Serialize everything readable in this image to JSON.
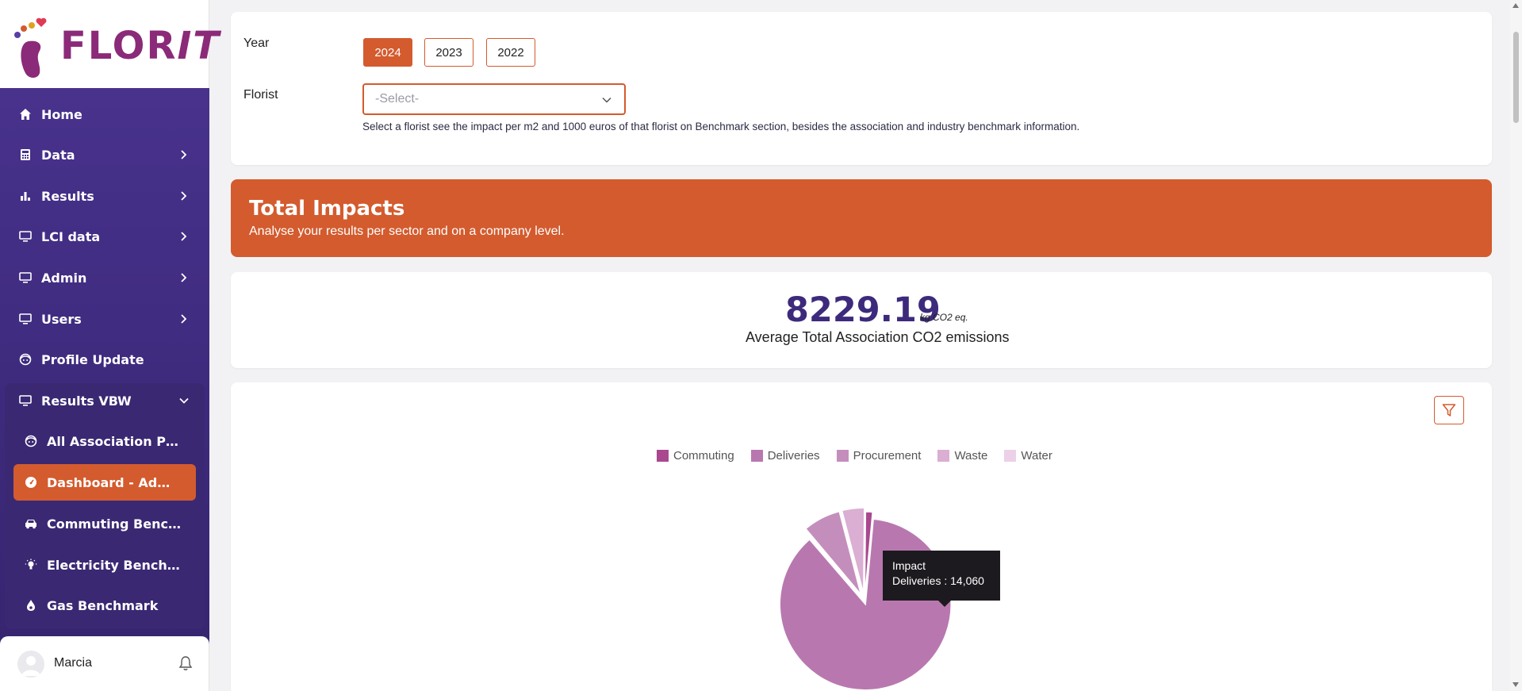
{
  "app": {
    "logo_text": "FLOR",
    "logo_text_italic": "IT"
  },
  "sidebar": {
    "items": [
      {
        "label": "Home",
        "icon": "home-icon",
        "has_chevron": false
      },
      {
        "label": "Data",
        "icon": "calculator-icon",
        "has_chevron": true
      },
      {
        "label": "Results",
        "icon": "bar-chart-icon",
        "has_chevron": true
      },
      {
        "label": "LCI data",
        "icon": "monitor-icon",
        "has_chevron": true
      },
      {
        "label": "Admin",
        "icon": "monitor-icon",
        "has_chevron": true
      },
      {
        "label": "Users",
        "icon": "monitor-icon",
        "has_chevron": true
      },
      {
        "label": "Profile Update",
        "icon": "face-icon",
        "has_chevron": false
      },
      {
        "label": "Results VBW",
        "icon": "monitor-icon",
        "has_chevron": true,
        "expanded": true
      }
    ],
    "subitems": [
      {
        "label": "All Association Profiles",
        "icon": "face-icon"
      },
      {
        "label": "Dashboard - Admin",
        "icon": "gauge-icon",
        "active": true
      },
      {
        "label": "Commuting Benchmark",
        "icon": "car-icon"
      },
      {
        "label": "Electricity Benchmark",
        "icon": "bulb-icon"
      },
      {
        "label": "Gas Benchmark",
        "icon": "flame-icon"
      }
    ],
    "user": {
      "name": "Marcia"
    }
  },
  "filters": {
    "year_label": "Year",
    "years": [
      "2024",
      "2023",
      "2022"
    ],
    "selected_year": "2024",
    "florist_label": "Florist",
    "florist_placeholder": "-Select-",
    "help_text": "Select a florist see the impact per m2 and 1000 euros of that florist on Benchmark section, besides the association and industry benchmark information."
  },
  "banner": {
    "title": "Total Impacts",
    "subtitle": "Analyse your results per sector and on a company level."
  },
  "summary": {
    "value": "8229.19",
    "unit": "kg CO2 eq.",
    "caption": "Average Total Association CO2 emissions"
  },
  "colors": {
    "primary": "#3d2a7c",
    "accent": "#d35b2e"
  },
  "chart_data": {
    "type": "pie",
    "series_name": "Impact",
    "categories": [
      "Commuting",
      "Deliveries",
      "Procurement",
      "Waste",
      "Water"
    ],
    "values": [
      211,
      14060,
      1140,
      680,
      30
    ],
    "colors": [
      "#a9488f",
      "#b878af",
      "#c48ebc",
      "#dbaed3",
      "#ecd0e8"
    ],
    "exploded": [
      "Procurement",
      "Waste"
    ],
    "legend_position": "top-center",
    "tooltip": {
      "title": "Impact",
      "label": "Deliveries",
      "value": "14,060"
    }
  }
}
